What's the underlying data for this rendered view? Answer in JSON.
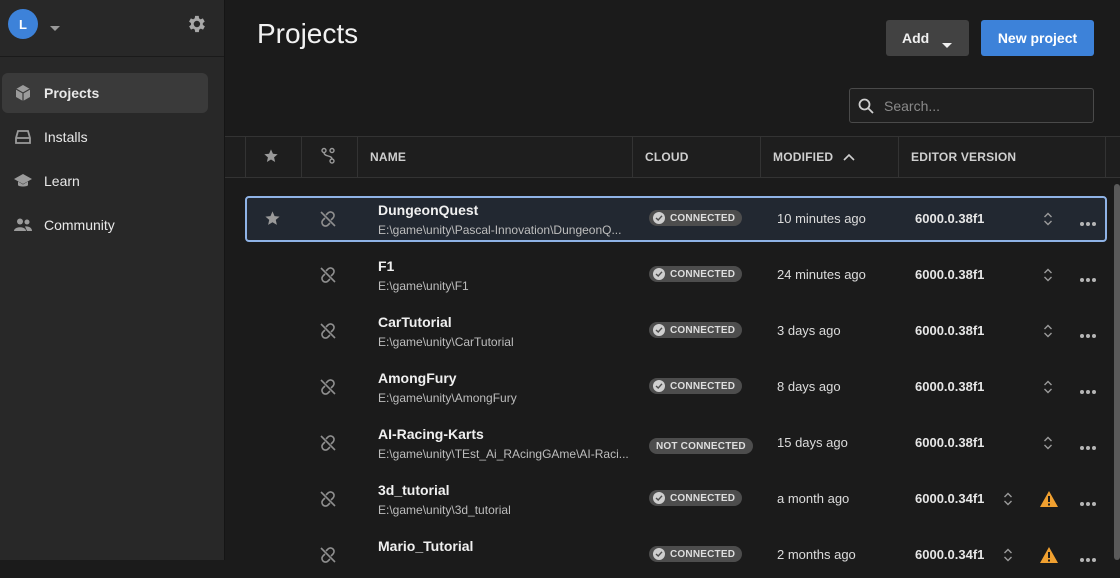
{
  "user": {
    "initial": "L"
  },
  "sidebar": {
    "items": [
      {
        "label": "Projects",
        "icon": "cube-icon",
        "active": true
      },
      {
        "label": "Installs",
        "icon": "drive-icon",
        "active": false
      },
      {
        "label": "Learn",
        "icon": "graduation-cap-icon",
        "active": false
      },
      {
        "label": "Community",
        "icon": "people-icon",
        "active": false
      }
    ]
  },
  "header": {
    "title": "Projects",
    "add_label": "Add",
    "new_project_label": "New project",
    "search_placeholder": "Search..."
  },
  "table": {
    "columns": {
      "name": "NAME",
      "cloud": "CLOUD",
      "modified": "MODIFIED",
      "editor_version": "EDITOR VERSION"
    },
    "rows": [
      {
        "name": "DungeonQuest",
        "path": "E:\\game\\unity\\Pascal-Innovation\\DungeonQ...",
        "cloud": "CONNECTED",
        "modified": "10 minutes ago",
        "version": "6000.0.38f1",
        "starred": true,
        "selected": true,
        "warning": false
      },
      {
        "name": "F1",
        "path": "E:\\game\\unity\\F1",
        "cloud": "CONNECTED",
        "modified": "24 minutes ago",
        "version": "6000.0.38f1",
        "starred": false,
        "selected": false,
        "warning": false
      },
      {
        "name": "CarTutorial",
        "path": "E:\\game\\unity\\CarTutorial",
        "cloud": "CONNECTED",
        "modified": "3 days ago",
        "version": "6000.0.38f1",
        "starred": false,
        "selected": false,
        "warning": false
      },
      {
        "name": "AmongFury",
        "path": "E:\\game\\unity\\AmongFury",
        "cloud": "CONNECTED",
        "modified": "8 days ago",
        "version": "6000.0.38f1",
        "starred": false,
        "selected": false,
        "warning": false
      },
      {
        "name": "AI-Racing-Karts",
        "path": "E:\\game\\unity\\TEst_Ai_RAcingGAme\\AI-Raci...",
        "cloud": "NOT CONNECTED",
        "modified": "15 days ago",
        "version": "6000.0.38f1",
        "starred": false,
        "selected": false,
        "warning": false
      },
      {
        "name": "3d_tutorial",
        "path": "E:\\game\\unity\\3d_tutorial",
        "cloud": "CONNECTED",
        "modified": "a month ago",
        "version": "6000.0.34f1",
        "starred": false,
        "selected": false,
        "warning": true
      },
      {
        "name": "Mario_Tutorial",
        "path": "",
        "cloud": "CONNECTED",
        "modified": "2 months ago",
        "version": "6000.0.34f1",
        "starred": false,
        "selected": false,
        "warning": true
      }
    ]
  },
  "colors": {
    "accent": "#3d82d9",
    "warning": "#f0a030",
    "background": "#1b1b1b",
    "sidebar": "#282828"
  }
}
